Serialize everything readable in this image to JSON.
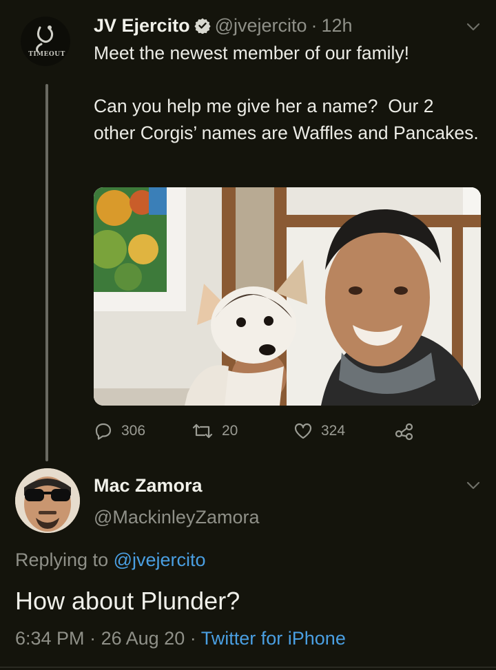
{
  "tweet": {
    "avatar_logo_text": "TIMEOUT",
    "name": "JV Ejercito",
    "handle": "@jvejercito",
    "separator": "·",
    "time": "12h",
    "text": "Meet the newest member of our family!\n\nCan you help me give her a name?  Our 2 other Corgis’ names are Waffles and Pancakes.",
    "actions": {
      "replies": "306",
      "retweets": "20",
      "likes": "324"
    }
  },
  "reply": {
    "name": "Mac Zamora",
    "handle": "@MackinleyZamora",
    "replying_prefix": "Replying to",
    "replying_to": "@jvejercito",
    "text": "How about Plunder?",
    "time": "6:34 PM",
    "sep1": "·",
    "date": "26 Aug 20",
    "sep2": "·",
    "source": "Twitter for iPhone"
  },
  "colors": {
    "background": "#14140c",
    "link": "#4a9fe2",
    "secondary_text": "#8f9088",
    "verified": "#d8d8d0"
  },
  "icons": [
    "verified-badge-icon",
    "chevron-down-icon",
    "reply-icon",
    "retweet-icon",
    "like-icon",
    "share-icon"
  ]
}
